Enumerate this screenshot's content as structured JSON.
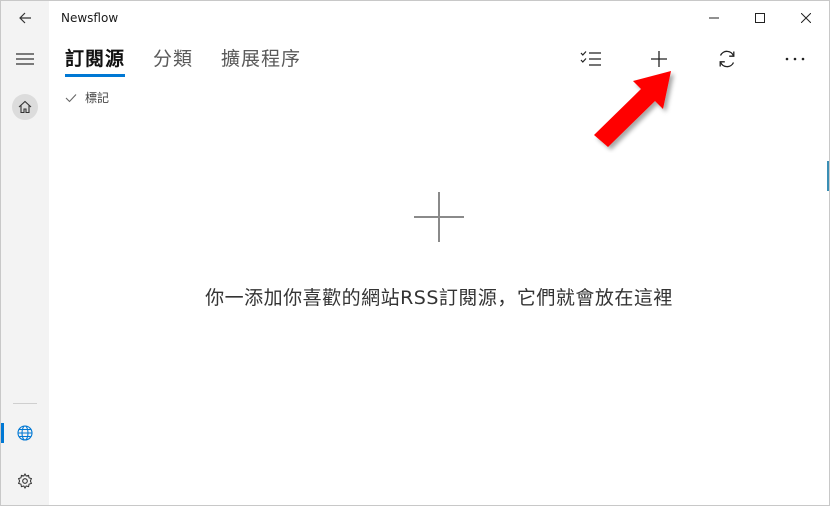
{
  "window": {
    "title": "Newsflow"
  },
  "tabs": [
    {
      "label": "訂閱源",
      "active": true
    },
    {
      "label": "分類",
      "active": false
    },
    {
      "label": "擴展程序",
      "active": false
    }
  ],
  "filter": {
    "label": "標記"
  },
  "empty_state": {
    "message": "你一添加你喜歡的網站RSS訂閱源，它們就會放在這裡"
  },
  "icons": {
    "back": "back-arrow-icon",
    "minimize": "minimize-icon",
    "maximize": "maximize-icon",
    "close": "close-icon",
    "menu": "hamburger-icon",
    "home": "home-icon",
    "globe": "globe-icon",
    "settings": "gear-icon",
    "select": "checklist-icon",
    "add": "plus-icon",
    "refresh": "refresh-icon",
    "more": "more-icon",
    "annotation": "red-arrow-pointer"
  },
  "colors": {
    "accent": "#0078d4",
    "annotation": "#ff0000"
  }
}
